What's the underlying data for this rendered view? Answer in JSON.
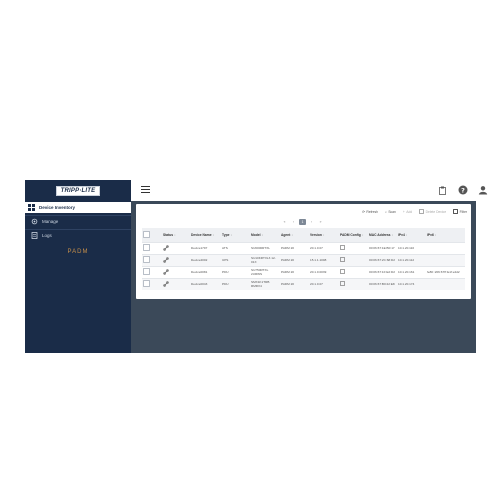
{
  "brand": {
    "logo": "TRIPP·LITE",
    "product": "PADM"
  },
  "sidebar": {
    "items": [
      {
        "label": "Device Inventory",
        "icon": "grid-icon",
        "active": true
      },
      {
        "label": "Manage",
        "icon": "gear-icon",
        "active": false
      },
      {
        "label": "Logs",
        "icon": "log-icon",
        "active": false
      }
    ]
  },
  "topbar": {
    "menu_icon": "hamburger-icon",
    "icons": [
      "clipboard-icon",
      "help-icon",
      "user-icon"
    ]
  },
  "toolbar": {
    "actions": [
      {
        "label": "Refresh",
        "icon": "refresh-icon"
      },
      {
        "label": "Scan",
        "icon": "scan-icon"
      },
      {
        "label": "Add",
        "icon": "plus-icon"
      },
      {
        "label": "Delete Device",
        "icon": "trash-icon"
      },
      {
        "label": "Filter",
        "icon": "filter-icon"
      }
    ]
  },
  "pager": {
    "prev": "‹",
    "first": "«",
    "current": "1",
    "next": "»",
    "last": "›"
  },
  "table": {
    "columns": [
      "Status",
      "Device Name",
      "Type",
      "Model",
      "Agent",
      "Version",
      "PADM Config",
      "MAC Address",
      "IPv4",
      "IPv6"
    ],
    "rows": [
      {
        "device": "Device1797",
        "type": "ATS",
        "model": "SU6000RTXL",
        "agent": "PADM 20",
        "version": "20.1.0.07",
        "mac": "00:06:67:1E:B0:17",
        "ipv4": "10.1.20.110",
        "ipv6": ""
      },
      {
        "device": "Device2002",
        "type": "UPS",
        "model": "SU10KRTXL3 12-01X",
        "agent": "PADM 20",
        "version": "15.1.1.1008",
        "mac": "00:06:67:2C:68:D2",
        "ipv4": "10.1.20.112",
        "ipv6": ""
      },
      {
        "device": "Device0081",
        "type": "PDU",
        "model": "SU750RTXL 2URWS",
        "agent": "PADM 20",
        "version": "20.1.0.0039",
        "mac": "00:06:67:1F:E2:D2",
        "ipv4": "10.1.20.161",
        "ipv6": "fe80::206:67ff:fe1f:e2d2"
      },
      {
        "device": "Device0043",
        "type": "PDU",
        "model": "SMX1K1TRB RMRX4",
        "agent": "PADM 20",
        "version": "20.1.0.07",
        "mac": "00:06:67:B0:22:E8",
        "ipv4": "10.1.20.174",
        "ipv6": ""
      }
    ]
  },
  "colors": {
    "sidebar": "#1a2c48",
    "main_bg": "#3b4959",
    "brand_accent": "#c8904a"
  }
}
